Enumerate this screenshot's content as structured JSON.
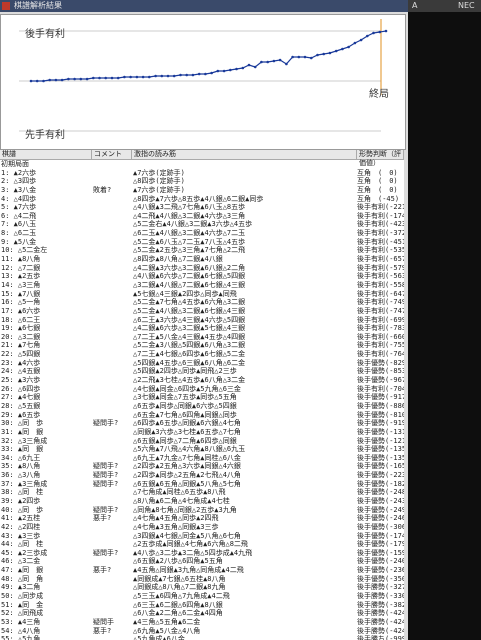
{
  "window": {
    "title": "棋譜解析結果"
  },
  "status_top_right": {
    "label": "A",
    "logo": "NEC"
  },
  "graph": {
    "top_label": "後手有利",
    "bottom_label": "先手有利",
    "end_label": "終局",
    "line_color": "#1a3a9a",
    "points": [
      0,
      0,
      0,
      1,
      1,
      1,
      2,
      2,
      2,
      2,
      3,
      3,
      3,
      3,
      3,
      4,
      4,
      4,
      4,
      4,
      5,
      5,
      5,
      5,
      6,
      6,
      6,
      7,
      7,
      8,
      10,
      10,
      11,
      12,
      13,
      16,
      14,
      19,
      19,
      20,
      21,
      17,
      24,
      24,
      24,
      23,
      26,
      27,
      28,
      30,
      32,
      34,
      38,
      41,
      45,
      48,
      49,
      50
    ]
  },
  "list": {
    "headers": {
      "no": "棋譜",
      "comment": "コメント",
      "reading": "激指の読み筋",
      "eval": "形勢判断（評価値）"
    },
    "rows": [
      {
        "no": "初期局面",
        "comment": "",
        "reading": "",
        "eval": ""
      },
      {
        "no": "1: ▲2六歩",
        "comment": "",
        "reading": "▲7六歩(定跡手)",
        "eval": "互角　(　0)"
      },
      {
        "no": "2: △3四歩",
        "comment": "",
        "reading": "△8四歩(定跡手)",
        "eval": "互角　(　0)"
      },
      {
        "no": "3: ▲3八金",
        "comment": "敗着?",
        "reading": "▲7六歩(定跡手)",
        "eval": "互角　(　0)"
      },
      {
        "no": "4: △4四歩",
        "comment": "",
        "reading": "△8四歩▲7六歩△8五歩▲4八銀△6二銀▲同歩",
        "eval": "互角　(-45)"
      },
      {
        "no": "5: ▲7六歩",
        "comment": "",
        "reading": "△4八銀▲3二飛△7七角▲6八玉△8五歩",
        "eval": "後手有利(-221)"
      },
      {
        "no": "6: △4二飛",
        "comment": "",
        "reading": "△4二飛▲4八銀△3二銀▲4六歩△3三角",
        "eval": "後手有利(-174)"
      },
      {
        "no": "7: ▲6八玉",
        "comment": "",
        "reading": "△5二金右▲4八銀△3二銀▲3六歩△4五歩",
        "eval": "後手有利(-423)"
      },
      {
        "no": "8: △6二玉",
        "comment": "",
        "reading": "△6二玉▲4八銀△3二銀▲4六歩△7二玉",
        "eval": "後手有利(-372)"
      },
      {
        "no": "9: ▲5八金",
        "comment": "",
        "reading": "△5二金▲6八玉△7二玉▲7八玉△4五歩",
        "eval": "後手有利(-451)"
      },
      {
        "no": "10: △5二金左",
        "comment": "",
        "reading": "△5二金▲2五歩△3三角▲7七角△2二飛",
        "eval": "後手有利(-535)"
      },
      {
        "no": "11: ▲8八角",
        "comment": "",
        "reading": "△8四歩▲8八角△7二銀▲4八銀",
        "eval": "後手有利(-657)"
      },
      {
        "no": "12: △7二銀",
        "comment": "",
        "reading": "△4二銀▲3六歩△3二銀▲6八銀△2二角",
        "eval": "後手有利(-579)"
      },
      {
        "no": "13: ▲2五歩",
        "comment": "",
        "reading": "△4八銀▲6六歩△7二銀▲6七銀△5四銀",
        "eval": "後手有利(-563)"
      },
      {
        "no": "14: △3三角",
        "comment": "",
        "reading": "△3二銀▲4八銀△7二銀▲6七銀△4三銀",
        "eval": "後手有利(-558)"
      },
      {
        "no": "15: ▲7八銀",
        "comment": "",
        "reading": "▲5七銀△4三銀▲2四歩△同歩▲同飛",
        "eval": "後手有利(-647)"
      },
      {
        "no": "16: △5一角",
        "comment": "",
        "reading": "△5二金▲7七角△4五歩▲6六角△3二銀",
        "eval": "後手有利(-749)"
      },
      {
        "no": "17: ▲6六歩",
        "comment": "",
        "reading": "△5二金▲4八銀△3二銀▲6七銀△4三銀",
        "eval": "後手有利(-747)"
      },
      {
        "no": "18: △6二王",
        "comment": "",
        "reading": "△6二王▲3六歩△4三銀▲4六歩△5四銀",
        "eval": "後手有利(-699)"
      },
      {
        "no": "19: ▲6七銀",
        "comment": "",
        "reading": "△4二銀▲6六歩△3二銀▲5七銀△4三銀",
        "eval": "後手有利(-783)"
      },
      {
        "no": "20: △3二銀",
        "comment": "",
        "reading": "△7二王▲5八金△4三銀▲4五歩△4四銀",
        "eval": "後手有利(-660)"
      },
      {
        "no": "21: ▲7七角",
        "comment": "",
        "reading": "△5二金▲3八銀△5四銀▲6八角△3二銀",
        "eval": "後手有利(-755)"
      },
      {
        "no": "22: △5四銀",
        "comment": "",
        "reading": "△7二王▲4七銀△6四歩▲6七銀△5二金",
        "eval": "後手有利(-764)"
      },
      {
        "no": "23: ▲4六歩",
        "comment": "",
        "reading": "△5四銀▲4五歩△6三銀▲6八角△6二金",
        "eval": "後手優勢(-829)"
      },
      {
        "no": "24: △4五銀",
        "comment": "",
        "reading": "△5四銀▲2四歩△同歩▲同飛△2三歩",
        "eval": "後手優勢(-853)"
      },
      {
        "no": "25: ▲3六歩",
        "comment": "",
        "reading": "△2二飛▲3七桂△4五歩▲6八角△3二金",
        "eval": "後手優勢(-967)"
      },
      {
        "no": "26: △6四歩",
        "comment": "",
        "reading": "△4七銀▲同金△6四歩▲5九角△6三金",
        "eval": "後手有利(-704)"
      },
      {
        "no": "27: ▲4七銀",
        "comment": "",
        "reading": "△3七銀▲同金△7五歩▲同歩△5五角",
        "eval": "後手優勢(-917)"
      },
      {
        "no": "28: △5五銀",
        "comment": "",
        "reading": "△6五歩▲同歩△同銀▲6六歩△5四銀",
        "eval": "後手優勢(-886)"
      },
      {
        "no": "29: ▲6五歩",
        "comment": "",
        "reading": "△6五金▲7七角△6四角▲同銀△同歩",
        "eval": "後手優勢(-810)"
      },
      {
        "no": "30: △同　歩",
        "comment": "疑問手?",
        "reading": "△6四歩▲6五歩△同銀▲6六銀△4七角",
        "eval": "後手優勢(-919)"
      },
      {
        "no": "31: ▲同　銀",
        "comment": "",
        "reading": "△同銀▲3六歩△3七桂▲6五歩△7七角",
        "eval": "後手優勢(-1313)"
      },
      {
        "no": "32: △3三角成",
        "comment": "",
        "reading": "△6五銀▲同歩△7二角▲6四歩△同銀",
        "eval": "後手優勢(-1210)"
      },
      {
        "no": "33: ▲同　銀",
        "comment": "",
        "reading": "△5六角▲7八飛△4六角▲8八銀△6九玉",
        "eval": "後手優勢(-1350)"
      },
      {
        "no": "34: △6九王",
        "comment": "",
        "reading": "△6九王▲7九金△7七角▲同桂△6八金",
        "eval": "後手優勢(-1359)"
      },
      {
        "no": "35: ▲8八角",
        "comment": "疑問手?",
        "reading": "△2四歩▲2五角△3六歩▲同銀△4六銀",
        "eval": "後手優勢(-1652)"
      },
      {
        "no": "36: △3八角",
        "comment": "疑問手?",
        "reading": "△2四歩▲同歩△2五角▲2七飛△4八角",
        "eval": "後手優勢(-2232)"
      },
      {
        "no": "37: ▲3三角成",
        "comment": "疑問手?",
        "reading": "△6五銀▲6五角△同銀▲5八角△5七角",
        "eval": "後手優勢(-1821)"
      },
      {
        "no": "38: △同　桂",
        "comment": "",
        "reading": "△7七角成▲同桂△6五歩▲8八飛",
        "eval": "後手優勢(-2480)"
      },
      {
        "no": "39: ▲2四歩",
        "comment": "",
        "reading": "△8八角▲6二角△4七角成▲4七桂",
        "eval": "後手優勢(-2431)"
      },
      {
        "no": "40: △同　歩",
        "comment": "疑問手?",
        "reading": "△同角▲8七角△同銀△2五歩▲3九角",
        "eval": "後手優勢(-2495)"
      },
      {
        "no": "41: ▲2五桂",
        "comment": "悪手?",
        "reading": "△4七角▲4五角△同歩▲2四飛",
        "eval": "後手優勢(-2462)"
      },
      {
        "no": "42: △2四桂",
        "comment": "",
        "reading": "△4七角▲3五角△同銀▲3三歩",
        "eval": "後手優勢(-3067)"
      },
      {
        "no": "43: ▲3三歩",
        "comment": "",
        "reading": "△3四銀▲4七銀△同金▲5八角△6七角",
        "eval": "後手優勢(-1745)"
      },
      {
        "no": "44: △同　桂",
        "comment": "",
        "reading": "△2五歩成▲同銀△4七角▲6六角△8二飛",
        "eval": "後手優勢(-1792)"
      },
      {
        "no": "45: ▲2三歩成",
        "comment": "疑問手?",
        "reading": "▲4八歩△3二歩▲3二角△5四歩成▲4九飛",
        "eval": "後手優勢(-1592)"
      },
      {
        "no": "46: △3二金",
        "comment": "",
        "reading": "△6五銀▲2八歩△6四角▲5五角",
        "eval": "後手優勢(-2406)"
      },
      {
        "no": "47: ▲同　銀",
        "comment": "悪手?",
        "reading": "▲4五角△同銀▲3九角△同角成▲4二飛",
        "eval": "後手優勢(-2361)"
      },
      {
        "no": "48: △同　角",
        "comment": "",
        "reading": "▲同銀成▲7七銀△6五桂▲8八角",
        "eval": "後手優勢(-3508)"
      },
      {
        "no": "49: ▲3二角",
        "comment": "",
        "reading": "△同銀成△8八角△7二銀▲8九角",
        "eval": "後手勝勢(-3273)"
      },
      {
        "no": "50: △同步成",
        "comment": "",
        "reading": "△5三玉▲6四角△7九角成▲4二飛",
        "eval": "後手勝勢(-3303)"
      },
      {
        "no": "51: ▲同　金",
        "comment": "",
        "reading": "△6三玉▲6二銀△6四角▲8八銀",
        "eval": "後手勝勢(-3820)"
      },
      {
        "no": "52: △同飛成",
        "comment": "",
        "reading": "△6八金▲2二角△6二金▲4四角",
        "eval": "後手勝勢(-4241)"
      },
      {
        "no": "53: ▲4三角",
        "comment": "疑問手",
        "reading": "▲4三角△5五角▲6二金",
        "eval": "後手勝勢(-4241)"
      },
      {
        "no": "54: △4八角",
        "comment": "悪手?",
        "reading": "△6九角▲5八金△4八角",
        "eval": "後手勝勢(-4241)"
      },
      {
        "no": "55: △5九角",
        "comment": "",
        "reading": "△5九角成▲6八金",
        "eval": "後手勝ち(-99997)"
      },
      {
        "no": "56: ▲6八金",
        "comment": "",
        "reading": "△同飛成▲同玉",
        "eval": "後手勝ち(-99998)"
      },
      {
        "no": "57: ▲5七玉",
        "comment": "",
        "reading": "△同玉",
        "eval": "後手勝ち(-99999)"
      },
      {
        "no": "58: △6七龍",
        "comment": "悪手?",
        "reading": "△5八銀",
        "eval": "後手勝ち(-99999)"
      }
    ]
  }
}
